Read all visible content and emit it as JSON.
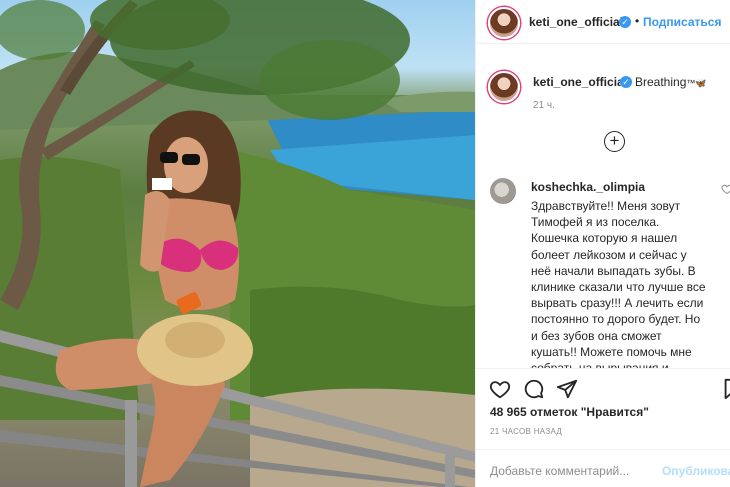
{
  "post": {
    "username": "keti_one_official",
    "follow_label": "Подписаться",
    "dot": "•",
    "caption": "Breathing",
    "caption_emoji": "™🦋",
    "time_ago": "21 ч.",
    "load_more_symbol": "+"
  },
  "comment": {
    "username": "koshechka._olimpia",
    "text": "Здравствуйте!! Меня зовут Тимофей я из поселка. Кошечка которую я нашел болеет лейкозом и сейчас у неё начали выпадать зубы. В клинике сказали что лучше все вырвать сразу!!! А лечить если постоянно то дорого будет. Но и без зубов она сможет кушать!! Можете помочь мне собрать на вырывания и дорогу в клинику ?"
  },
  "stats": {
    "likes": "48 965 отметок \"Нравится\"",
    "posted": "21 ЧАСОВ НАЗАД"
  },
  "composer": {
    "placeholder": "Добавьте комментарий...",
    "post_label": "Опубликовать"
  },
  "icons": {
    "verified": "verified-badge-icon",
    "heart": "heart-icon",
    "comment": "comment-icon",
    "share": "share-icon",
    "save": "bookmark-icon",
    "emoji": "emoji-icon",
    "plus": "plus-circle-icon"
  },
  "colors": {
    "accent": "#3897f0",
    "muted": "#8e8e8e",
    "border": "#efefef",
    "post_disabled": "#b2dffc"
  }
}
